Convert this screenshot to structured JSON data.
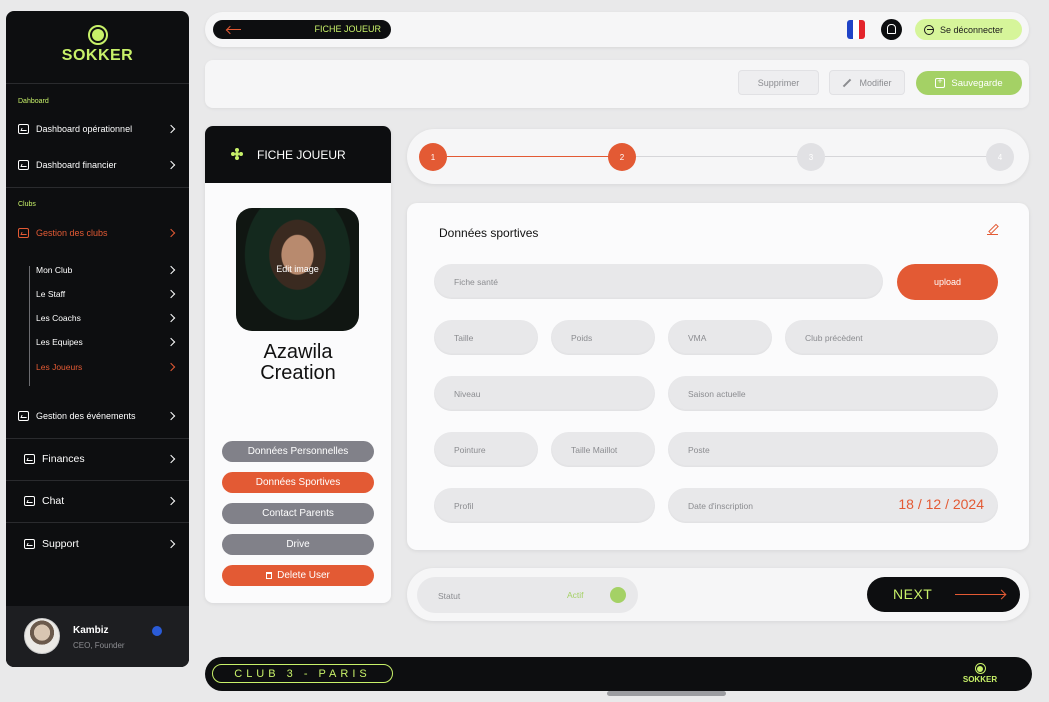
{
  "brand": {
    "name": "SOKKER",
    "accent": "#c8f169",
    "orange": "#e35a34"
  },
  "sidebar": {
    "sections": {
      "dashboard": "Dahboard",
      "clubs": "Clubs"
    },
    "items": {
      "dash_op": "Dashboard opérationnel",
      "dash_fin": "Dashboard financier",
      "gestion_clubs": "Gestion des clubs",
      "gestion_events": "Gestion des événements",
      "finances": "Finances",
      "chat": "Chat",
      "support": "Support"
    },
    "sub": {
      "mon_club": "Mon Club",
      "staff": "Le Staff",
      "coachs": "Les Coachs",
      "equipes": "Les Equipes",
      "joueurs": "Les Joueurs"
    },
    "user": {
      "name": "Kambiz",
      "role": "CEO, Founder"
    }
  },
  "topbar": {
    "title": "FICHE JOUEUR",
    "logout": "Se déconnecter"
  },
  "actions": {
    "delete": "Supprimer",
    "edit": "Modifier",
    "save": "Sauvegarde"
  },
  "player": {
    "header": "FICHE JOUEUR",
    "edit_image": "Edit image",
    "name_line1": "Azawila",
    "name_line2": "Creation",
    "tabs": {
      "personal": "Données Personnelles",
      "sport": "Données Sportives",
      "parents": "Contact Parents",
      "drive": "Drive",
      "delete": "Delete User"
    }
  },
  "stepper": {
    "steps": [
      "1",
      "2",
      "3",
      "4"
    ],
    "current": 2
  },
  "form": {
    "title": "Données sportives",
    "fiche_sante": "Fiche santé",
    "upload": "upload",
    "taille": "Taille",
    "poids": "Poids",
    "vma": "VMA",
    "club_prec": "Club précèdent",
    "niveau": "Niveau",
    "saison": "Saison actuelle",
    "pointure": "Pointure",
    "taille_maillot": "Taille Maillot",
    "poste": "Poste",
    "profil": "Profil",
    "date_inscription": "Date d'inscription",
    "date_value": "18 / 12 / 2024"
  },
  "status": {
    "label": "Statut",
    "value": "Actif"
  },
  "next": "NEXT",
  "bottom": {
    "club": "CLUB 3 - PARIS",
    "logo": "SOKKER"
  }
}
